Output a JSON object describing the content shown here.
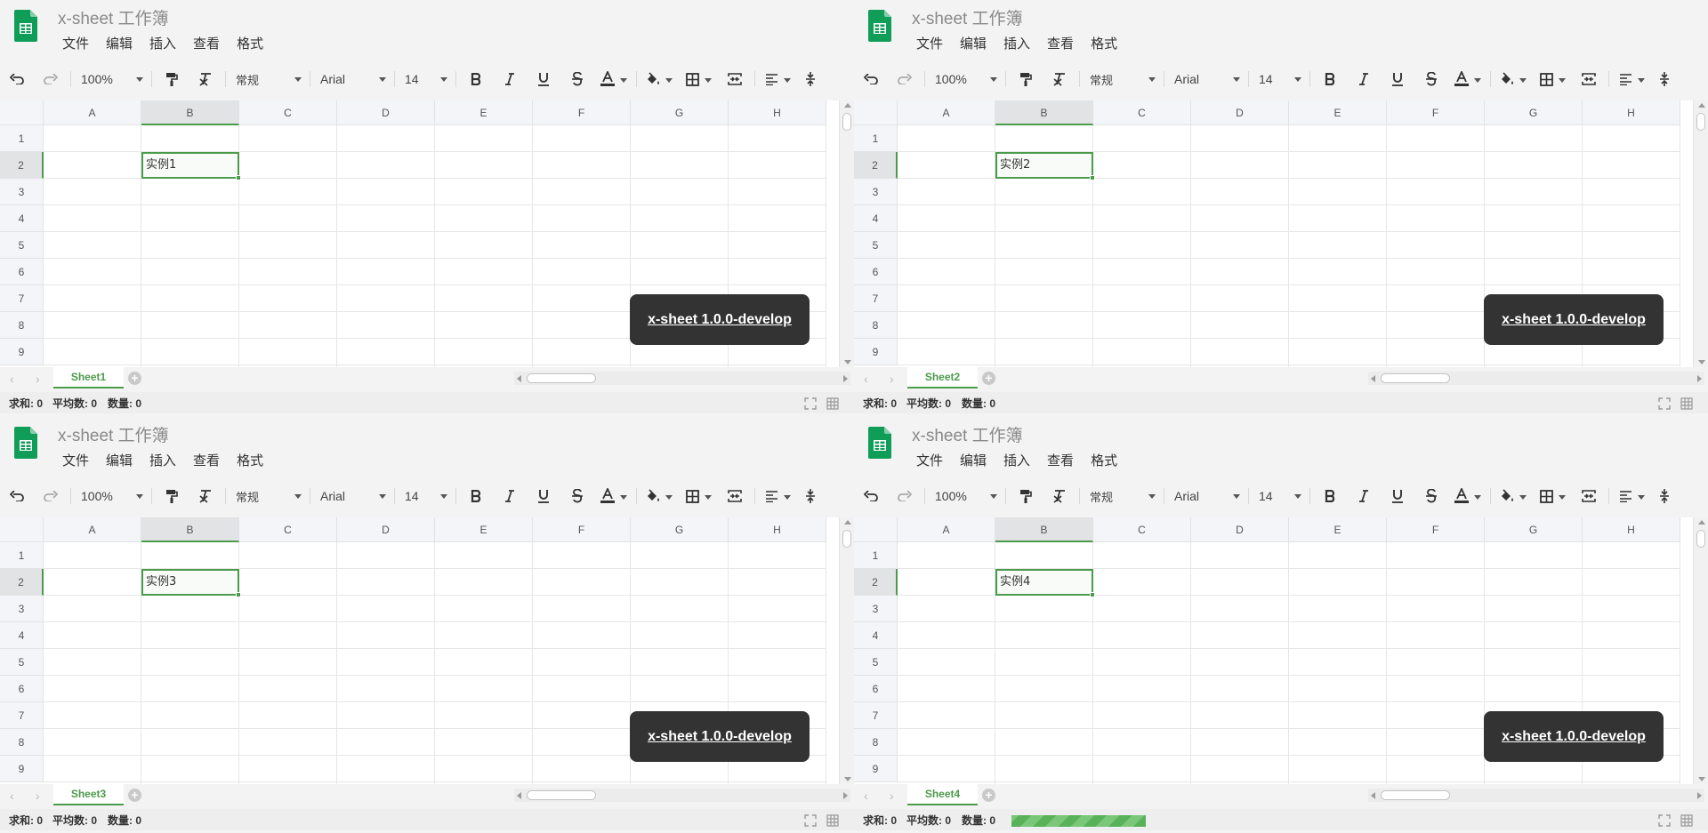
{
  "app": {
    "title": "x-sheet 工作簿",
    "menu": [
      "文件",
      "编辑",
      "插入",
      "查看",
      "格式"
    ],
    "brand_color": "#0f9d58",
    "accent_color": "#4b9b4b"
  },
  "toolbar": {
    "zoom": "100%",
    "format": "常规",
    "font": "Arial",
    "font_size": "14",
    "icons": [
      "undo-icon",
      "redo-icon",
      "paint-format-icon",
      "clear-format-icon",
      "bold-icon",
      "italic-icon",
      "underline-icon",
      "strikethrough-icon",
      "text-color-icon",
      "fill-color-icon",
      "border-icon",
      "merge-icon",
      "align-icon",
      "valign-icon"
    ]
  },
  "sheet": {
    "columns": [
      "A",
      "B",
      "C",
      "D",
      "E",
      "F",
      "G",
      "H"
    ],
    "rows": [
      "1",
      "2",
      "3",
      "4",
      "5",
      "6",
      "7",
      "8",
      "9"
    ],
    "selected_column": "B",
    "selected_row": "2",
    "toast": "x-sheet 1.0.0-develop"
  },
  "status": {
    "sum_label": "求和:",
    "avg_label": "平均数:",
    "count_label": "数量:",
    "sum": "0",
    "avg": "0",
    "count": "0"
  },
  "workbooks": [
    {
      "sheet_name": "Sheet1",
      "cell_value": "实例1",
      "loading": false
    },
    {
      "sheet_name": "Sheet2",
      "cell_value": "实例2",
      "loading": false
    },
    {
      "sheet_name": "Sheet3",
      "cell_value": "实例3",
      "loading": false
    },
    {
      "sheet_name": "Sheet4",
      "cell_value": "实例4",
      "loading": true
    }
  ]
}
